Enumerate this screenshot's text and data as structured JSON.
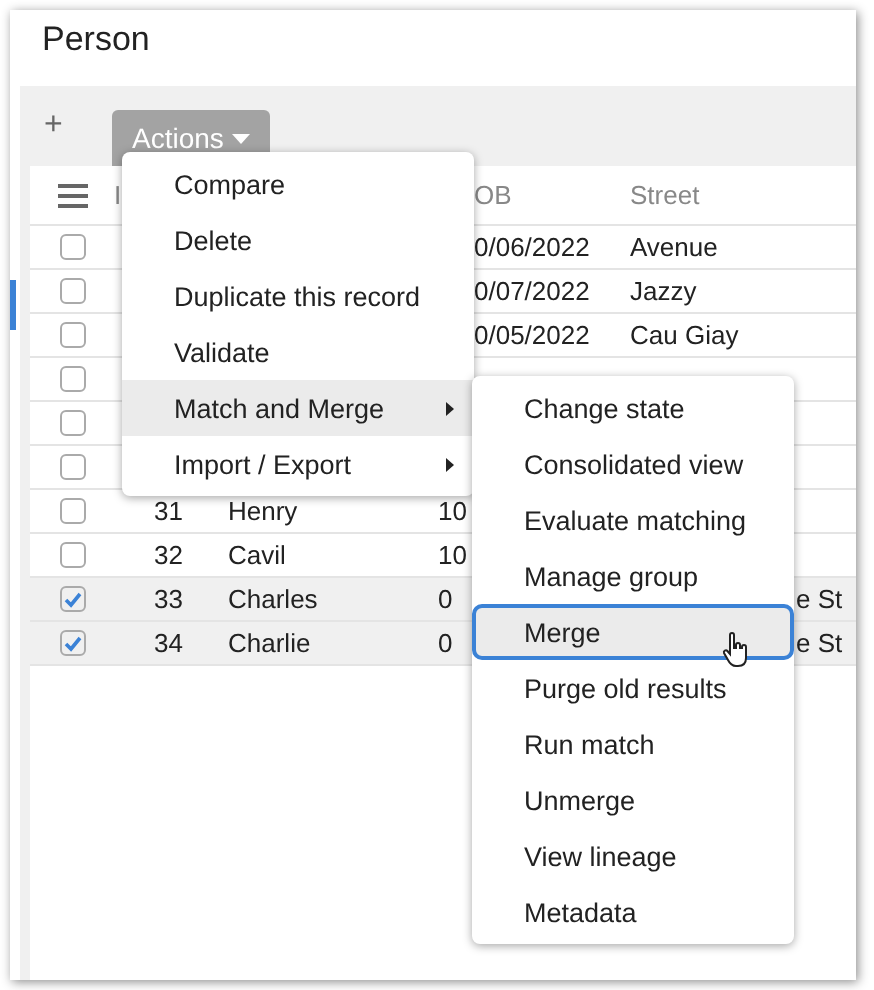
{
  "title": "Person",
  "toolbar": {
    "add": "+",
    "actions": "Actions"
  },
  "table": {
    "columns": [
      "I",
      "OB",
      "Street"
    ],
    "rows": [
      {
        "checked": false,
        "dob": "0/06/2022",
        "street": "Avenue"
      },
      {
        "checked": false,
        "dob": "0/07/2022",
        "street": "Jazzy"
      },
      {
        "checked": false,
        "dob": "0/05/2022",
        "street": "Cau Giay"
      },
      {
        "checked": false
      },
      {
        "checked": false
      },
      {
        "checked": false
      },
      {
        "checked": false,
        "id": "31",
        "name": "Henry",
        "dob": "10"
      },
      {
        "checked": false,
        "id": "32",
        "name": "Cavil",
        "dob": "10"
      },
      {
        "checked": true,
        "id": "33",
        "name": "Charles",
        "dob": "0",
        "street": "e St"
      },
      {
        "checked": true,
        "id": "34",
        "name": "Charlie",
        "dob": "0",
        "street": "e St"
      }
    ]
  },
  "menu": [
    {
      "label": "Compare",
      "submenu": false,
      "selected": false
    },
    {
      "label": "Delete",
      "submenu": false,
      "selected": false
    },
    {
      "label": "Duplicate this record",
      "submenu": false,
      "selected": false
    },
    {
      "label": "Validate",
      "submenu": false,
      "selected": false
    },
    {
      "label": "Match and Merge",
      "submenu": true,
      "selected": true
    },
    {
      "label": "Import / Export",
      "submenu": true,
      "selected": false
    }
  ],
  "submenu": [
    {
      "label": "Change state",
      "selected": false
    },
    {
      "label": "Consolidated view",
      "selected": false
    },
    {
      "label": "Evaluate matching",
      "selected": false
    },
    {
      "label": "Manage group",
      "selected": false
    },
    {
      "label": "Merge",
      "selected": true
    },
    {
      "label": "Purge old results",
      "selected": false
    },
    {
      "label": "Run match",
      "selected": false
    },
    {
      "label": "Unmerge",
      "selected": false
    },
    {
      "label": "View lineage",
      "selected": false
    },
    {
      "label": "Metadata",
      "selected": false
    }
  ]
}
